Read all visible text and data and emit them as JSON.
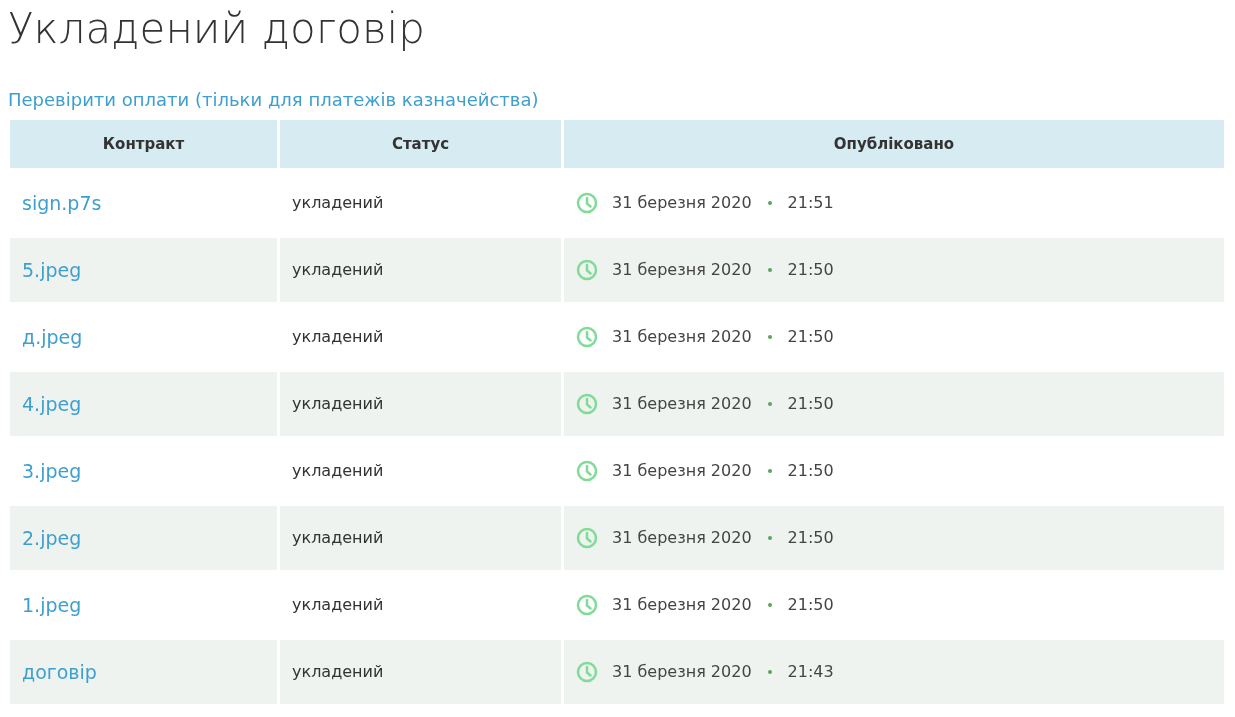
{
  "title": "Укладений договір",
  "check_link": "Перевірити оплати (тільки для платежів казначейства)",
  "table": {
    "columns": [
      "Контракт",
      "Статус",
      "Опубліковано"
    ],
    "rows": [
      {
        "file": "sign.p7s",
        "status": "укладений",
        "date": "31 березня 2020",
        "time": "21:51"
      },
      {
        "file": "5.jpeg",
        "status": "укладений",
        "date": "31 березня 2020",
        "time": "21:50"
      },
      {
        "file": "д.jpeg",
        "status": "укладений",
        "date": "31 березня 2020",
        "time": "21:50"
      },
      {
        "file": "4.jpeg",
        "status": "укладений",
        "date": "31 березня 2020",
        "time": "21:50"
      },
      {
        "file": "3.jpeg",
        "status": "укладений",
        "date": "31 березня 2020",
        "time": "21:50"
      },
      {
        "file": "2.jpeg",
        "status": "укладений",
        "date": "31 березня 2020",
        "time": "21:50"
      },
      {
        "file": "1.jpeg",
        "status": "укладений",
        "date": "31 березня 2020",
        "time": "21:50"
      },
      {
        "file": "договір",
        "status": "укладений",
        "date": "31 березня 2020",
        "time": "21:43"
      }
    ]
  }
}
